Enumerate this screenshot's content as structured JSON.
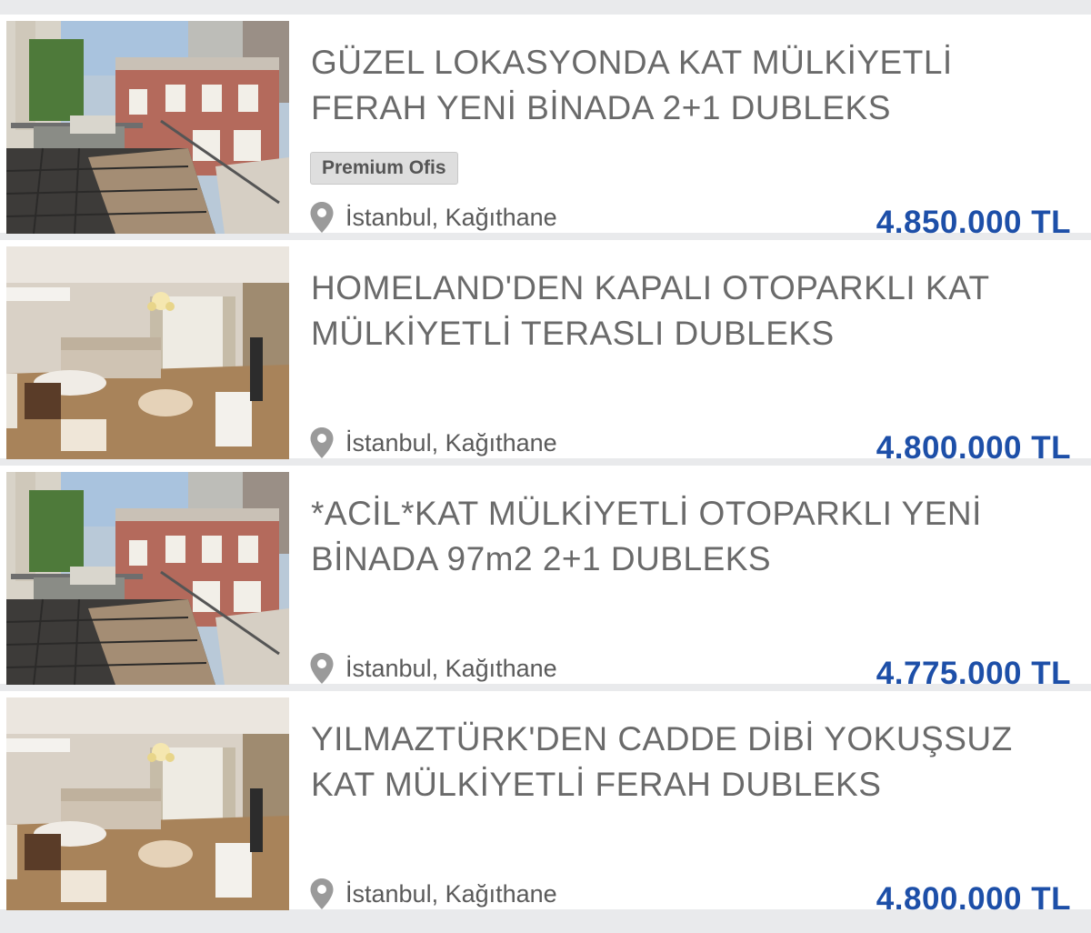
{
  "listings": [
    {
      "title": "GÜZEL LOKASYONDA KAT MÜLKİYETLİ\nFERAH YENİ BİNADA 2+1 DUBLEKS",
      "badge": "Premium Ofis",
      "location": "İstanbul, Kağıthane",
      "price": "4.850.000 TL",
      "photo": "terrace-photo"
    },
    {
      "title": "HOMELAND'DEN KAPALI OTOPARKLI KAT\nMÜLKİYETLİ TERASLI DUBLEKS",
      "badge": "",
      "location": "İstanbul, Kağıthane",
      "price": "4.800.000 TL",
      "photo": "living-room-photo"
    },
    {
      "title": "*ACİL*KAT MÜLKİYETLİ OTOPARKLI YENİ\nBİNADA 97m2 2+1 DUBLEKS",
      "badge": "",
      "location": "İstanbul, Kağıthane",
      "price": "4.775.000 TL",
      "photo": "terrace-photo"
    },
    {
      "title": "YILMAZTÜRK'DEN CADDE DİBİ YOKUŞSUZ\nKAT MÜLKİYETLİ FERAH DUBLEKS",
      "badge": "",
      "location": "İstanbul, Kağıthane",
      "price": "4.800.000 TL",
      "photo": "living-room-photo"
    }
  ],
  "colors": {
    "price": "#1d4fa8",
    "title": "#6a6a6a",
    "background": "#e9eaec",
    "card": "#ffffff"
  },
  "icons": {
    "location": "map-pin-icon"
  }
}
